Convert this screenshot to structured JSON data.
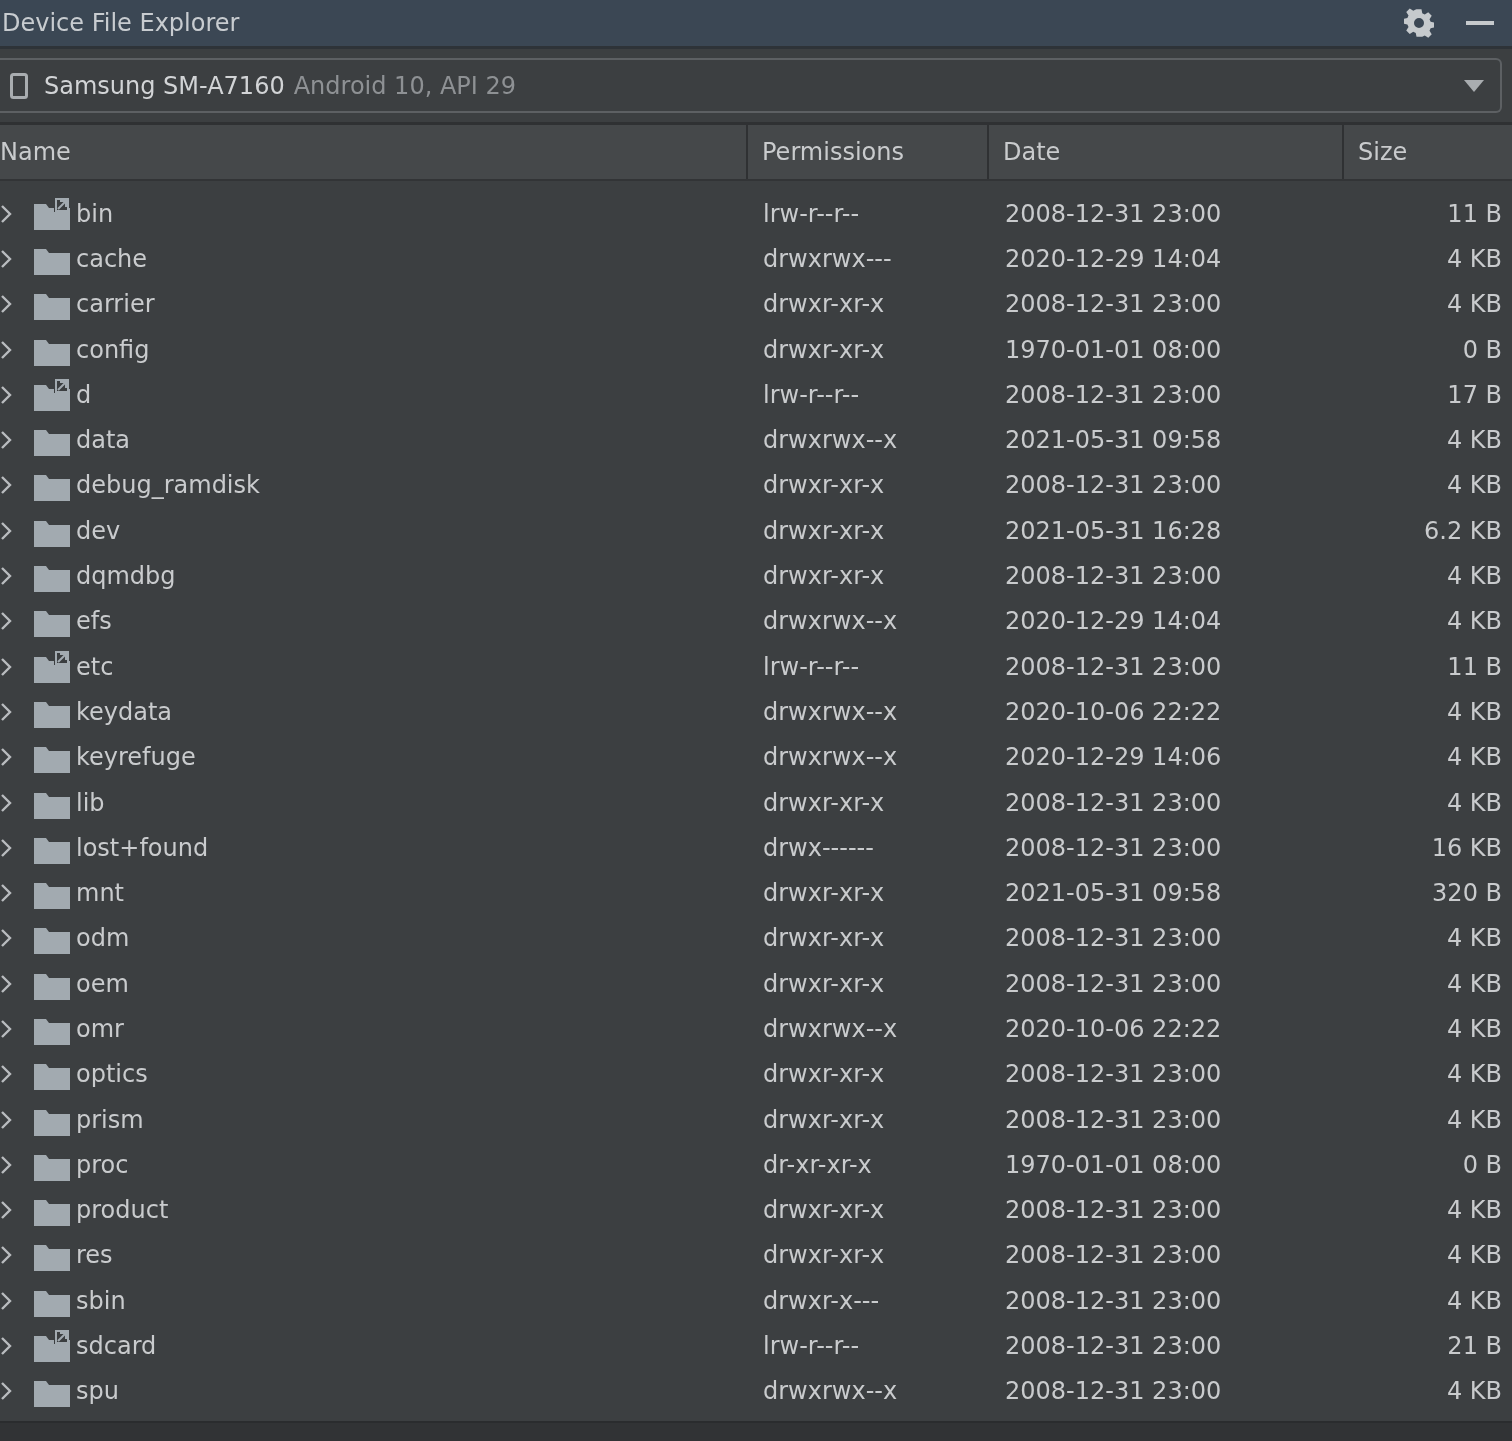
{
  "window": {
    "title": "Device File Explorer"
  },
  "device": {
    "name": "Samsung SM-A7160",
    "details": "Android 10, API 29"
  },
  "table": {
    "columns": [
      "Name",
      "Permissions",
      "Date",
      "Size"
    ],
    "rows": [
      {
        "name": "bin",
        "kind": "link",
        "permissions": "lrw-r--r--",
        "date": "2008-12-31 23:00",
        "size": "11 B"
      },
      {
        "name": "cache",
        "kind": "folder",
        "permissions": "drwxrwx---",
        "date": "2020-12-29 14:04",
        "size": "4 KB"
      },
      {
        "name": "carrier",
        "kind": "folder",
        "permissions": "drwxr-xr-x",
        "date": "2008-12-31 23:00",
        "size": "4 KB"
      },
      {
        "name": "config",
        "kind": "folder",
        "permissions": "drwxr-xr-x",
        "date": "1970-01-01 08:00",
        "size": "0 B"
      },
      {
        "name": "d",
        "kind": "link",
        "permissions": "lrw-r--r--",
        "date": "2008-12-31 23:00",
        "size": "17 B"
      },
      {
        "name": "data",
        "kind": "folder",
        "permissions": "drwxrwx--x",
        "date": "2021-05-31 09:58",
        "size": "4 KB"
      },
      {
        "name": "debug_ramdisk",
        "kind": "folder",
        "permissions": "drwxr-xr-x",
        "date": "2008-12-31 23:00",
        "size": "4 KB"
      },
      {
        "name": "dev",
        "kind": "folder",
        "permissions": "drwxr-xr-x",
        "date": "2021-05-31 16:28",
        "size": "6.2 KB"
      },
      {
        "name": "dqmdbg",
        "kind": "folder",
        "permissions": "drwxr-xr-x",
        "date": "2008-12-31 23:00",
        "size": "4 KB"
      },
      {
        "name": "efs",
        "kind": "folder",
        "permissions": "drwxrwx--x",
        "date": "2020-12-29 14:04",
        "size": "4 KB"
      },
      {
        "name": "etc",
        "kind": "link",
        "permissions": "lrw-r--r--",
        "date": "2008-12-31 23:00",
        "size": "11 B"
      },
      {
        "name": "keydata",
        "kind": "folder",
        "permissions": "drwxrwx--x",
        "date": "2020-10-06 22:22",
        "size": "4 KB"
      },
      {
        "name": "keyrefuge",
        "kind": "folder",
        "permissions": "drwxrwx--x",
        "date": "2020-12-29 14:06",
        "size": "4 KB"
      },
      {
        "name": "lib",
        "kind": "folder",
        "permissions": "drwxr-xr-x",
        "date": "2008-12-31 23:00",
        "size": "4 KB"
      },
      {
        "name": "lost+found",
        "kind": "folder",
        "permissions": "drwx------",
        "date": "2008-12-31 23:00",
        "size": "16 KB"
      },
      {
        "name": "mnt",
        "kind": "folder",
        "permissions": "drwxr-xr-x",
        "date": "2021-05-31 09:58",
        "size": "320 B"
      },
      {
        "name": "odm",
        "kind": "folder",
        "permissions": "drwxr-xr-x",
        "date": "2008-12-31 23:00",
        "size": "4 KB"
      },
      {
        "name": "oem",
        "kind": "folder",
        "permissions": "drwxr-xr-x",
        "date": "2008-12-31 23:00",
        "size": "4 KB"
      },
      {
        "name": "omr",
        "kind": "folder",
        "permissions": "drwxrwx--x",
        "date": "2020-10-06 22:22",
        "size": "4 KB"
      },
      {
        "name": "optics",
        "kind": "folder",
        "permissions": "drwxr-xr-x",
        "date": "2008-12-31 23:00",
        "size": "4 KB"
      },
      {
        "name": "prism",
        "kind": "folder",
        "permissions": "drwxr-xr-x",
        "date": "2008-12-31 23:00",
        "size": "4 KB"
      },
      {
        "name": "proc",
        "kind": "folder",
        "permissions": "dr-xr-xr-x",
        "date": "1970-01-01 08:00",
        "size": "0 B"
      },
      {
        "name": "product",
        "kind": "folder",
        "permissions": "drwxr-xr-x",
        "date": "2008-12-31 23:00",
        "size": "4 KB"
      },
      {
        "name": "res",
        "kind": "folder",
        "permissions": "drwxr-xr-x",
        "date": "2008-12-31 23:00",
        "size": "4 KB"
      },
      {
        "name": "sbin",
        "kind": "folder",
        "permissions": "drwxr-x---",
        "date": "2008-12-31 23:00",
        "size": "4 KB"
      },
      {
        "name": "sdcard",
        "kind": "link",
        "permissions": "lrw-r--r--",
        "date": "2008-12-31 23:00",
        "size": "21 B"
      },
      {
        "name": "spu",
        "kind": "folder",
        "permissions": "drwxrwx--x",
        "date": "2008-12-31 23:00",
        "size": "4 KB"
      }
    ]
  }
}
